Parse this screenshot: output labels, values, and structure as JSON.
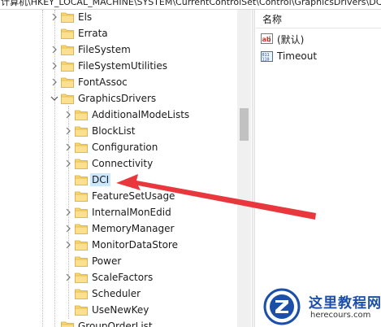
{
  "address_bar": {
    "path": "计算机\\HKEY_LOCAL_MACHINE\\SYSTEM\\CurrentControlSet\\Control\\GraphicsDrivers\\DCI"
  },
  "tree": {
    "items": [
      {
        "label": "Els",
        "expandable": true,
        "expanded": false,
        "selected": false,
        "level": 1
      },
      {
        "label": "Errata",
        "expandable": false,
        "expanded": false,
        "selected": false,
        "level": 1
      },
      {
        "label": "FileSystem",
        "expandable": true,
        "expanded": false,
        "selected": false,
        "level": 1
      },
      {
        "label": "FileSystemUtilities",
        "expandable": true,
        "expanded": false,
        "selected": false,
        "level": 1
      },
      {
        "label": "FontAssoc",
        "expandable": true,
        "expanded": false,
        "selected": false,
        "level": 1
      },
      {
        "label": "GraphicsDrivers",
        "expandable": true,
        "expanded": true,
        "selected": false,
        "level": 1
      },
      {
        "label": "AdditionalModeLists",
        "expandable": true,
        "expanded": false,
        "selected": false,
        "level": 2
      },
      {
        "label": "BlockList",
        "expandable": true,
        "expanded": false,
        "selected": false,
        "level": 2
      },
      {
        "label": "Configuration",
        "expandable": true,
        "expanded": false,
        "selected": false,
        "level": 2
      },
      {
        "label": "Connectivity",
        "expandable": true,
        "expanded": false,
        "selected": false,
        "level": 2
      },
      {
        "label": "DCI",
        "expandable": false,
        "expanded": false,
        "selected": true,
        "level": 2
      },
      {
        "label": "FeatureSetUsage",
        "expandable": false,
        "expanded": false,
        "selected": false,
        "level": 2
      },
      {
        "label": "InternalMonEdid",
        "expandable": true,
        "expanded": false,
        "selected": false,
        "level": 2
      },
      {
        "label": "MemoryManager",
        "expandable": true,
        "expanded": false,
        "selected": false,
        "level": 2
      },
      {
        "label": "MonitorDataStore",
        "expandable": true,
        "expanded": false,
        "selected": false,
        "level": 2
      },
      {
        "label": "Power",
        "expandable": false,
        "expanded": false,
        "selected": false,
        "level": 2
      },
      {
        "label": "ScaleFactors",
        "expandable": true,
        "expanded": false,
        "selected": false,
        "level": 2
      },
      {
        "label": "Scheduler",
        "expandable": false,
        "expanded": false,
        "selected": false,
        "level": 2
      },
      {
        "label": "UseNewKey",
        "expandable": false,
        "expanded": false,
        "selected": false,
        "level": 2
      },
      {
        "label": "GroupOrderList",
        "expandable": false,
        "expanded": false,
        "selected": false,
        "level": 1
      }
    ]
  },
  "values_pane": {
    "column_header": "名称",
    "values": [
      {
        "name": "(默认)",
        "icon": "string-value-icon"
      },
      {
        "name": "Timeout",
        "icon": "binary-value-icon"
      }
    ]
  },
  "annotation": {
    "arrow_color": "#e8383d"
  },
  "watermark": {
    "title": "这里教程网",
    "url": "herecours.com"
  },
  "colors": {
    "selection": "#cce8ff",
    "folder": "#f8d775",
    "watermark_blue": "#1b4fa8"
  }
}
